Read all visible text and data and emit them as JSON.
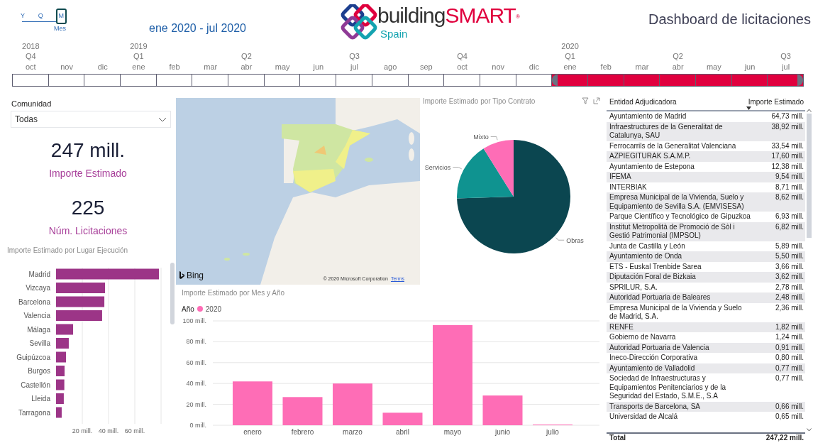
{
  "header": {
    "granularity": {
      "options": [
        {
          "label": "Y",
          "selected": false
        },
        {
          "label": "Q",
          "selected": false
        },
        {
          "label": "M",
          "selected": true
        }
      ],
      "caption": "Mes"
    },
    "date_range": "ene 2020 - jul 2020",
    "logo": {
      "word_1": "building",
      "word_2": "SMART",
      "mark": "®",
      "subtitle": "Spain"
    },
    "title": "Dashboard de licitaciones"
  },
  "timeline": {
    "months": [
      {
        "label": "oct",
        "year": "2018",
        "quarter": "Q4",
        "selected": false
      },
      {
        "label": "nov",
        "selected": false
      },
      {
        "label": "dic",
        "selected": false
      },
      {
        "label": "ene",
        "year": "2019",
        "quarter": "Q1",
        "selected": false
      },
      {
        "label": "feb",
        "selected": false
      },
      {
        "label": "mar",
        "selected": false
      },
      {
        "label": "abr",
        "quarter": "Q2",
        "selected": false
      },
      {
        "label": "may",
        "selected": false
      },
      {
        "label": "jun",
        "selected": false
      },
      {
        "label": "jul",
        "quarter": "Q3",
        "selected": false
      },
      {
        "label": "ago",
        "selected": false
      },
      {
        "label": "sep",
        "selected": false
      },
      {
        "label": "oct",
        "quarter": "Q4",
        "selected": false
      },
      {
        "label": "nov",
        "selected": false
      },
      {
        "label": "dic",
        "selected": false
      },
      {
        "label": "ene",
        "year": "2020",
        "quarter": "Q1",
        "selected": true
      },
      {
        "label": "feb",
        "selected": true
      },
      {
        "label": "mar",
        "selected": true
      },
      {
        "label": "abr",
        "quarter": "Q2",
        "selected": true
      },
      {
        "label": "may",
        "selected": true
      },
      {
        "label": "jun",
        "selected": true
      },
      {
        "label": "jul",
        "quarter": "Q3",
        "selected": true
      }
    ]
  },
  "filter": {
    "label": "Comunidad",
    "value": "Todas"
  },
  "kpis": [
    {
      "value": "247 mill.",
      "label": "Importe Estimado"
    },
    {
      "value": "225",
      "label": "Núm. Licitaciones"
    }
  ],
  "place_chart": {
    "chart_data": {
      "type": "bar",
      "orientation": "horizontal",
      "title": "Importe Estimado por Lugar Ejecución",
      "categories": [
        "Madrid",
        "Vizcaya",
        "Barcelona",
        "Valencia",
        "Málaga",
        "Sevilla",
        "Guipúzcoa",
        "Burgos",
        "Castellón",
        "Lleida",
        "Tarragona"
      ],
      "series": [
        {
          "color": "#9c3587",
          "values": [
            78.4,
            37.3,
            36.8,
            35.1,
            13,
            9.7,
            7.6,
            6.5,
            6.3,
            5.9,
            4.3
          ]
        }
      ],
      "xlim": [
        0,
        80
      ],
      "grid": true,
      "xticks": [
        {
          "value": 20,
          "label": "20 mill."
        },
        {
          "value": 40,
          "label": "40 mill."
        },
        {
          "value": 60,
          "label": "60 mill."
        }
      ]
    }
  },
  "map": {
    "kind": "picture",
    "provider": "Bing",
    "copyright": "© 2020 Microsoft Corporation",
    "link": "Terms"
  },
  "contract_chart": {
    "chart_data": {
      "type": "pie",
      "title": "Importe Estimado por Tipo Contrato",
      "categories": [
        "Obras",
        "Servicios",
        "Mixto"
      ],
      "values": [
        74.5,
        16.6,
        8.9
      ]
    }
  },
  "month_chart": {
    "legend_title": "Año",
    "chart_data": {
      "type": "bar",
      "title": "Importe Estimado por Mes y Año",
      "categories": [
        "enero",
        "febrero",
        "marzo",
        "abril",
        "mayo",
        "junio",
        "julio"
      ],
      "series": [
        {
          "name": "2020",
          "color": "#fe6db6",
          "values": [
            42,
            27,
            40,
            12,
            96,
            28.5,
            0.7
          ]
        }
      ],
      "ylim": [
        0,
        100
      ],
      "grid": true,
      "yticks": [
        {
          "value": 0,
          "label": "0 mill."
        },
        {
          "value": 20,
          "label": "20 mill."
        },
        {
          "value": 40,
          "label": "40 mill."
        },
        {
          "value": 60,
          "label": "60 mill."
        },
        {
          "value": 80,
          "label": "80 mill."
        },
        {
          "value": 100,
          "label": "100 mill."
        }
      ]
    }
  },
  "table": {
    "columns": [
      {
        "label": "Entidad Adjudicadora",
        "sorted": false
      },
      {
        "label": "Importe Estimado",
        "sorted": true
      }
    ],
    "rows": [
      {
        "entity": "Ayuntamiento de Madrid",
        "amount": "64,73 mill."
      },
      {
        "entity": "Infraestructures de la Generalitat de Catalunya, SAU",
        "amount": "38,92 mill."
      },
      {
        "entity": "Ferrocarrils de la Generalitat Valenciana",
        "amount": "33,54 mill."
      },
      {
        "entity": "AZPIEGITURAK S.A.M.P.",
        "amount": "17,60 mill."
      },
      {
        "entity": "Ayuntamiento de Estepona",
        "amount": "12,38 mill."
      },
      {
        "entity": "IFEMA",
        "amount": "9,54 mill."
      },
      {
        "entity": "INTERBIAK",
        "amount": "8,71 mill."
      },
      {
        "entity": "Empresa Municipal de la Vivienda, Suelo y Equipamiento de Sevilla S.A. (EMVISESA)",
        "amount": "8,62 mill."
      },
      {
        "entity": "Parque Científico y Tecnológico de Gipuzkoa",
        "amount": "6,93 mill."
      },
      {
        "entity": "Institut Metropolità de Promoció de Sòl i Gestió Patrimonial (IMPSOL)",
        "amount": "6,82 mill."
      },
      {
        "entity": "Junta de Castilla y León",
        "amount": "5,89 mill."
      },
      {
        "entity": "Ayuntamiento de Onda",
        "amount": "5,50 mill."
      },
      {
        "entity": "ETS - Euskal Trenbide Sarea",
        "amount": "3,66 mill."
      },
      {
        "entity": "Diputación Foral de Bizkaia",
        "amount": "3,62 mill."
      },
      {
        "entity": "SPRILUR, S.A.",
        "amount": "2,78 mill."
      },
      {
        "entity": "Autoridad Portuaria de Baleares",
        "amount": "2,48 mill."
      },
      {
        "entity": "Empresa Municipal de la Vivienda y Suelo de Madrid, S.A.",
        "amount": "2,36 mill."
      },
      {
        "entity": "RENFE",
        "amount": "1,82 mill."
      },
      {
        "entity": "Gobierno de Navarra",
        "amount": "1,24 mill."
      },
      {
        "entity": "Autoridad Portuaria de Valencia",
        "amount": "0,91 mill."
      },
      {
        "entity": "Ineco-Dirección Corporativa",
        "amount": "0,80 mill."
      },
      {
        "entity": "Ayuntamiento de Valladolid",
        "amount": "0,77 mill."
      },
      {
        "entity": "Sociedad de Infraestructuras y Equipamientos Penitenciarios y de la Seguridad del Estado, S.M.E., S.A",
        "amount": "0,77 mill."
      },
      {
        "entity": "Transports de Barcelona, SA",
        "amount": "0,66 mill."
      },
      {
        "entity": "Universidad de Alcalá",
        "amount": "0,65 mill."
      }
    ],
    "total": {
      "label": "Total",
      "amount": "247,22 mill."
    }
  }
}
